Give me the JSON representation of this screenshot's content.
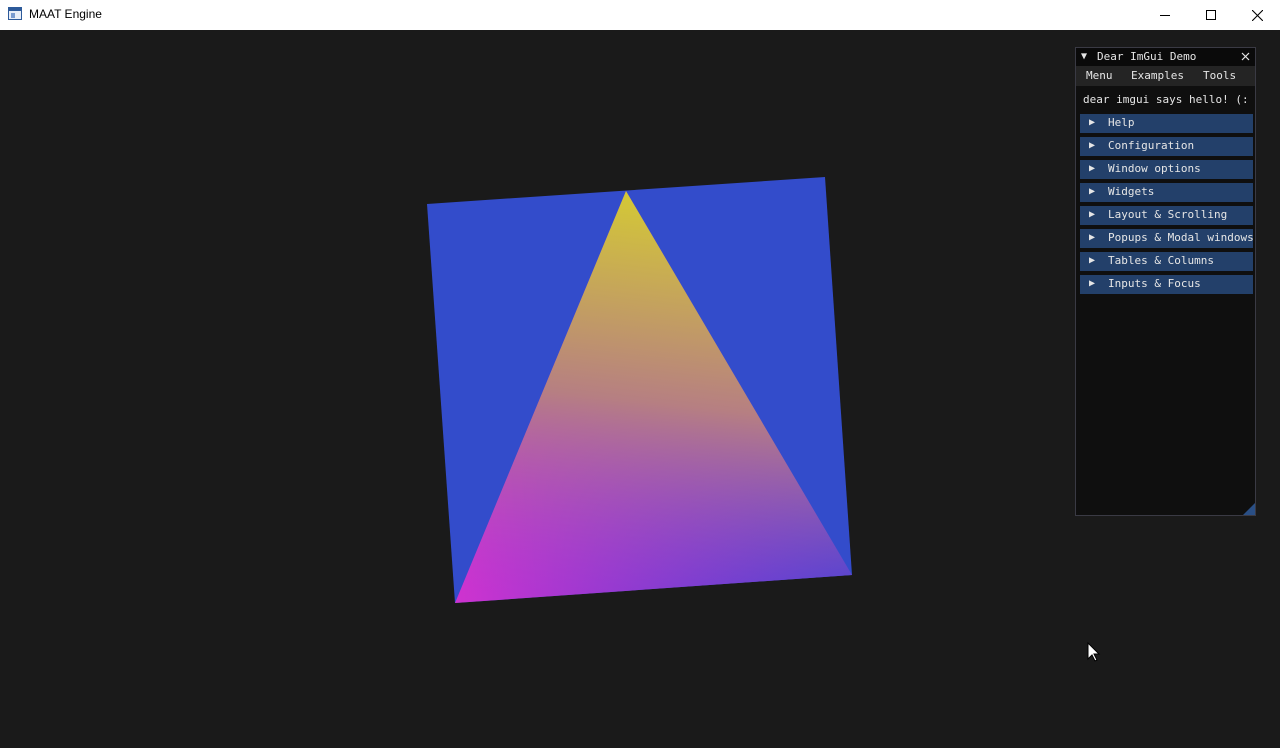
{
  "window": {
    "title": "MAAT Engine",
    "icon": "app-window-icon",
    "controls": [
      "minimize-icon",
      "maximize-icon",
      "close-icon"
    ]
  },
  "scene": {
    "background_color": "#1a1a1a",
    "quad_color": "#334ccb",
    "triangle_vertex_colors": {
      "top": "#d2c63a",
      "bottom_left": "#cf33cf",
      "bottom_right": "#3f3fd8"
    }
  },
  "imgui": {
    "title": "Dear ImGui Demo",
    "collapse_icon": "triangle-down-icon",
    "close_icon": "close-icon",
    "menu": [
      "Menu",
      "Examples",
      "Tools"
    ],
    "hello_text": "dear imgui says hello! (:",
    "headers": [
      "Help",
      "Configuration",
      "Window options",
      "Widgets",
      "Layout & Scrolling",
      "Popups & Modal windows",
      "Tables & Columns",
      "Inputs & Focus"
    ],
    "header_color": "#23406a"
  },
  "cursor": "mouse-pointer-icon"
}
